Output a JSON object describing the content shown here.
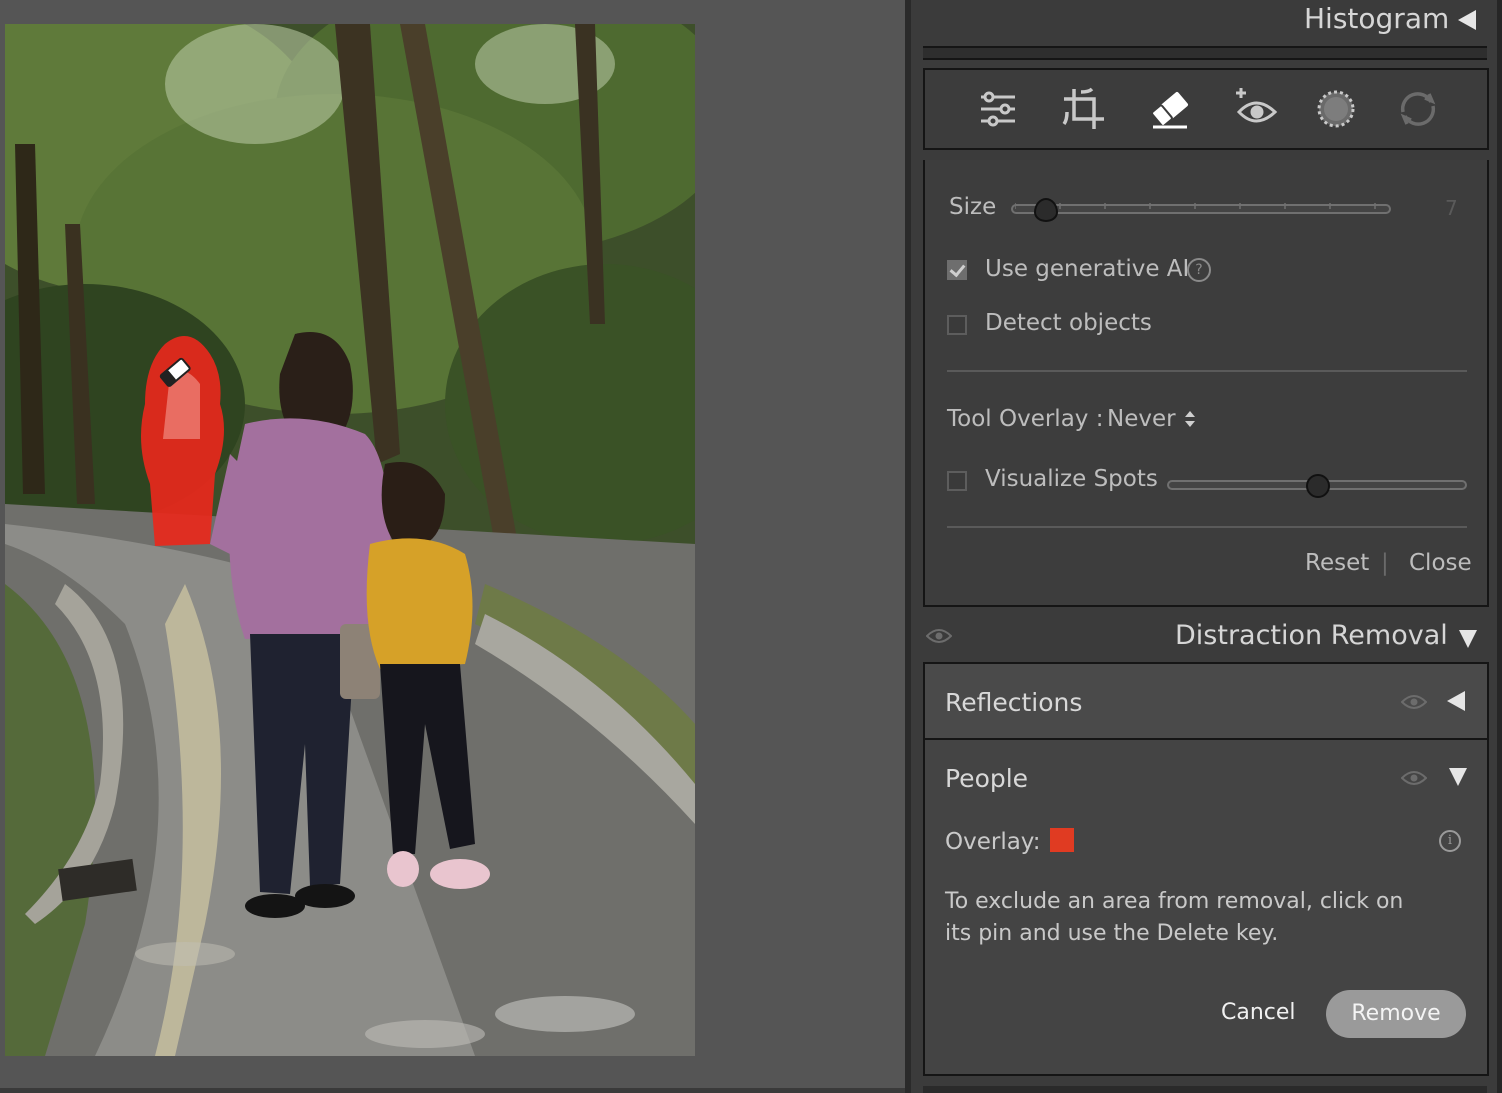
{
  "panel": {
    "histogram_title": "Histogram",
    "tools": [
      {
        "name": "edit-sliders",
        "icon": "sliders-icon"
      },
      {
        "name": "crop",
        "icon": "crop-icon"
      },
      {
        "name": "remove",
        "icon": "eraser-icon"
      },
      {
        "name": "red-eye",
        "icon": "red-eye-icon"
      },
      {
        "name": "masking",
        "icon": "mask-icon"
      },
      {
        "name": "presets",
        "icon": "presets-icon"
      }
    ],
    "options": {
      "size_label": "Size",
      "size_value": "7",
      "size_level": 0.09,
      "use_ai_label": "Use generative AI",
      "use_ai_checked": true,
      "help_glyph": "?",
      "detect_objects_label": "Detect objects",
      "detect_objects_checked": false,
      "tool_overlay_label": "Tool Overlay :",
      "tool_overlay_value": "Never",
      "visualize_spots_label": "Visualize Spots",
      "visualize_spots_checked": false,
      "visualize_level": 0.5,
      "reset_label": "Reset",
      "separator": "|",
      "close_label": "Close"
    },
    "distraction_removal": {
      "title": "Distraction Removal",
      "reflections_label": "Reflections",
      "people_label": "People",
      "overlay_label": "Overlay:",
      "overlay_color": "#e03b22",
      "info_glyph": "i",
      "instructions_line1": "To exclude an area from removal, click on",
      "instructions_line2": "its pin and use the Delete key.",
      "cancel_label": "Cancel",
      "remove_label": "Remove"
    }
  },
  "colors": {
    "panel_bg": "#3b3b3b",
    "canvas_bg": "#555555",
    "selection_overlay": "#e8281c"
  }
}
